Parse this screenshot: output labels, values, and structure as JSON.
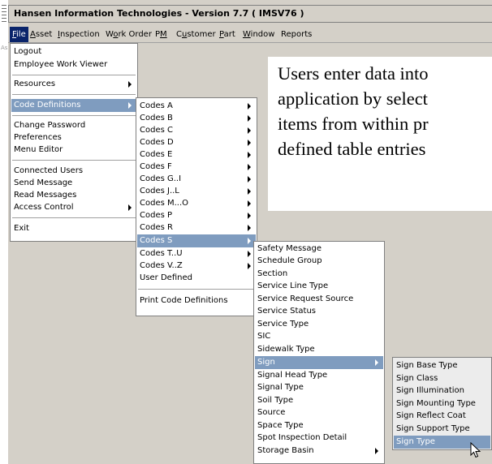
{
  "window": {
    "title": "Hansen Information Technologies - Version 7.7 ( IMSV76 )",
    "left_label": "As"
  },
  "menubar": [
    {
      "label": "File",
      "active": true
    },
    {
      "label": "Asset"
    },
    {
      "label": "Inspection"
    },
    {
      "label": "Work Order"
    },
    {
      "label": "PM"
    },
    {
      "label": "Customer"
    },
    {
      "label": "Part"
    },
    {
      "label": "Window"
    },
    {
      "label": "Reports"
    }
  ],
  "note": {
    "lines": [
      "Users enter data into",
      "application by select",
      "items from  within pr",
      "defined table entries"
    ]
  },
  "file_menu": {
    "items": [
      {
        "label": "Logout"
      },
      {
        "label": "Employee Work Viewer"
      },
      {
        "label": "Resources",
        "submenu": true
      },
      {
        "label": "Code Definitions",
        "submenu": true,
        "highlighted": true
      },
      {
        "label": "Change Password"
      },
      {
        "label": "Preferences"
      },
      {
        "label": "Menu Editor"
      },
      {
        "label": "Connected Users"
      },
      {
        "label": "Send Message"
      },
      {
        "label": "Read Messages"
      },
      {
        "label": "Access Control",
        "submenu": true
      },
      {
        "label": "Exit"
      }
    ]
  },
  "codes_menu": {
    "items": [
      {
        "label": "Codes A",
        "submenu": true
      },
      {
        "label": "Codes B",
        "submenu": true
      },
      {
        "label": "Codes C",
        "submenu": true
      },
      {
        "label": "Codes D",
        "submenu": true
      },
      {
        "label": "Codes E",
        "submenu": true
      },
      {
        "label": "Codes F",
        "submenu": true
      },
      {
        "label": "Codes G..I",
        "submenu": true
      },
      {
        "label": "Codes J..L",
        "submenu": true
      },
      {
        "label": "Codes M...O",
        "submenu": true
      },
      {
        "label": "Codes P",
        "submenu": true
      },
      {
        "label": "Codes R",
        "submenu": true
      },
      {
        "label": "Codes S",
        "submenu": true,
        "highlighted": true
      },
      {
        "label": "Codes T..U",
        "submenu": true
      },
      {
        "label": "Codes V..Z",
        "submenu": true
      },
      {
        "label": "User Defined"
      },
      {
        "label": "Print Code Definitions"
      }
    ]
  },
  "codes_s_menu": {
    "items": [
      {
        "label": "Safety Message"
      },
      {
        "label": "Schedule Group"
      },
      {
        "label": "Section"
      },
      {
        "label": "Service Line Type"
      },
      {
        "label": "Service Request Source"
      },
      {
        "label": "Service Status"
      },
      {
        "label": "Service Type"
      },
      {
        "label": "SIC"
      },
      {
        "label": "Sidewalk Type"
      },
      {
        "label": "Sign",
        "submenu": true,
        "highlighted": true
      },
      {
        "label": "Signal Head Type"
      },
      {
        "label": "Signal Type"
      },
      {
        "label": "Soil Type"
      },
      {
        "label": "Source"
      },
      {
        "label": "Space Type"
      },
      {
        "label": "Spot Inspection Detail"
      },
      {
        "label": "Storage Basin",
        "submenu": true
      }
    ]
  },
  "sign_menu": {
    "items": [
      {
        "label": "Sign Base Type"
      },
      {
        "label": "Sign Class"
      },
      {
        "label": "Sign Illumination"
      },
      {
        "label": "Sign Mounting Type"
      },
      {
        "label": "Sign Reflect Coat"
      },
      {
        "label": "Sign Support Type"
      },
      {
        "label": "Sign Type",
        "highlighted": true
      }
    ]
  }
}
